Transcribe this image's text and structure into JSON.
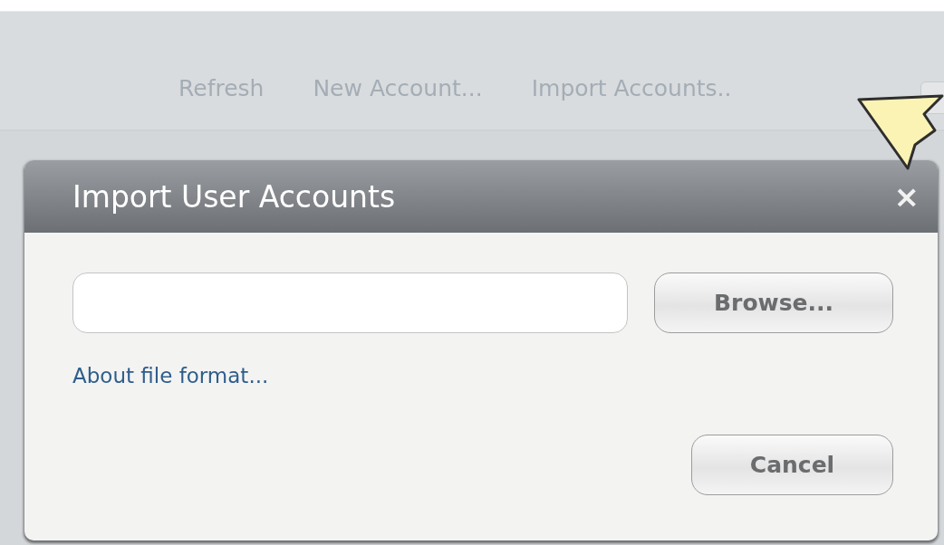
{
  "toolbar": {
    "links": [
      "Refresh",
      "New Account...",
      "Import Accounts.."
    ]
  },
  "dialog": {
    "title": "Import User Accounts",
    "close": "×",
    "browse_button": "Browse...",
    "help_link": "About file format...",
    "cancel_button": "Cancel"
  }
}
